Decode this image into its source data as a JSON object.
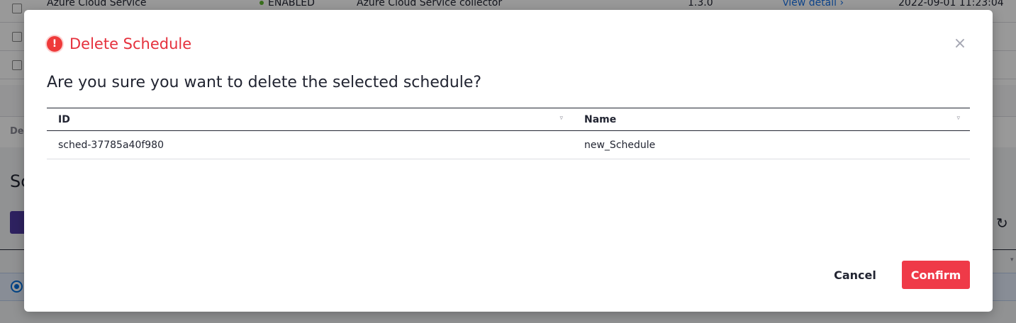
{
  "background": {
    "rows": [
      {
        "name": "Azure Cloud Service",
        "status": "ENABLED",
        "collector": "Azure Cloud Service collector",
        "version": "1.3.0",
        "link": "view detail ›",
        "date": "2022-09-01 11:23:04"
      }
    ],
    "label_fragment": "De",
    "heading_fragment": "Sc",
    "refresh_icon": "refresh-icon",
    "caret_icon": "chevron-down-icon"
  },
  "modal": {
    "alert_icon": "alert-circle-icon",
    "alert_glyph": "!",
    "title": "Delete Schedule",
    "close_glyph": "×",
    "question": "Are you sure you want to delete the selected schedule?",
    "table": {
      "headers": {
        "id": "ID",
        "name": "Name"
      },
      "sort_glyph": "▿",
      "rows": [
        {
          "id": "sched-37785a40f980",
          "name": "new_Schedule"
        }
      ]
    },
    "buttons": {
      "cancel": "Cancel",
      "confirm": "Confirm"
    }
  },
  "colors": {
    "danger": "#ef3a48",
    "title_red": "#e5303c",
    "text": "#222532",
    "overlay": "rgba(0,0,0,0.4)",
    "primary_purple": "#4d3aa0",
    "selected_row": "#e3ecfb"
  }
}
